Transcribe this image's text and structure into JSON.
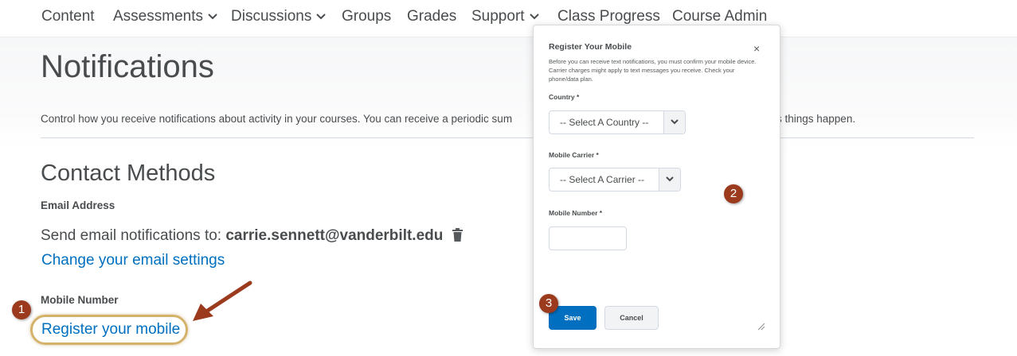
{
  "nav": {
    "items": [
      {
        "label": "Content"
      },
      {
        "label": "Assessments"
      },
      {
        "label": "Discussions"
      },
      {
        "label": "Groups"
      },
      {
        "label": "Grades"
      },
      {
        "label": "Support"
      },
      {
        "label": "Class Progress"
      },
      {
        "label": "Course Admin"
      }
    ]
  },
  "page": {
    "title": "Notifications",
    "intro": "Control how you receive notifications about activity in your courses. You can receive a periodic sum",
    "intro_tail": "s things happen."
  },
  "contact": {
    "title": "Contact Methods",
    "email_label": "Email Address",
    "email_prefix": "Send email notifications to:",
    "email_value": "carrie.sennett@vanderbilt.edu",
    "change_email_link": "Change your email settings",
    "mobile_label": "Mobile Number",
    "register_link": "Register your mobile"
  },
  "dialog": {
    "title": "Register Your Mobile",
    "close": "×",
    "description": "Before you can receive text notifications, you must confirm your mobile device. Carrier charges might apply to text messages you receive. Check your phone/data plan.",
    "country_label": "Country *",
    "country_value": "-- Select A Country --",
    "carrier_label": "Mobile Carrier *",
    "carrier_value": "-- Select A Carrier --",
    "number_label": "Mobile Number *",
    "number_value": "",
    "save_label": "Save",
    "cancel_label": "Cancel"
  },
  "annotations": {
    "step1": "1",
    "step2": "2",
    "step3": "3",
    "badge_color": "#9b3a1d",
    "highlight_color": "#d4b26a"
  },
  "colors": {
    "link": "#006fbf",
    "primary_button": "#006fbf",
    "text": "#494c4e"
  }
}
